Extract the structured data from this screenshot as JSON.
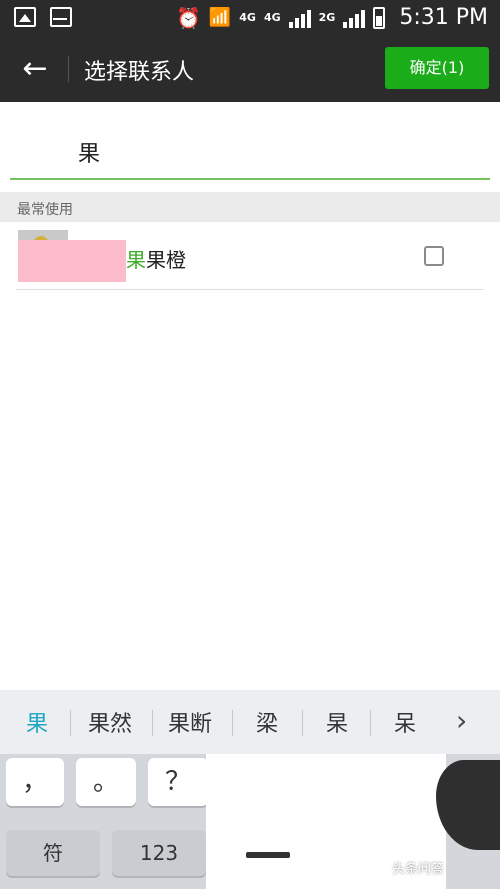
{
  "status_bar": {
    "net_4g": "4G",
    "sim1": "4G",
    "sim2": "2G",
    "time": "5:31 PM"
  },
  "header": {
    "back_icon": "arrow-left-icon",
    "title": "选择联系人",
    "confirm_label": "确定(1)"
  },
  "search": {
    "query": "果"
  },
  "section": {
    "label": "最常使用"
  },
  "contacts": [
    {
      "name_highlight": "果",
      "name_rest": "果橙",
      "checked": false
    }
  ],
  "candidates": {
    "items": [
      "果",
      "果然",
      "果断",
      "梁",
      "杲",
      "呆"
    ],
    "active_index": 0,
    "more_icon": "chevron-right-icon"
  },
  "keyboard": {
    "row1": [
      "，",
      "。",
      "？"
    ],
    "row2": [
      "符",
      "123"
    ]
  },
  "watermark": "头条问答",
  "colors": {
    "bar": "#2b2b2b",
    "confirm": "#1aad19",
    "highlight": "#3fae2a",
    "candidate_active": "#22a6c3"
  }
}
